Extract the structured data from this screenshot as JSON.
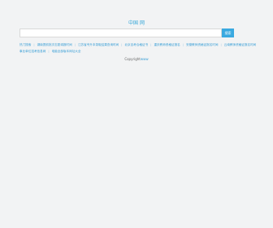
{
  "header": {
    "title": "中国 网"
  },
  "search": {
    "placeholder": "",
    "button_label": "搜索"
  },
  "links": {
    "row1": [
      "热门搜索",
      "湖南提前批次志愿填报时间",
      "江苏省专升本录取结果查询时间",
      "北京自考合格证书",
      "重庆教师资格证报名",
      "安徽教师资格证报名时间",
      "云南教师资格证报名时间"
    ],
    "row2": [
      "事业单位招考信息网",
      "电脑全部版本网址大全"
    ]
  },
  "footer": {
    "copyright": "Copyright",
    "site": "www"
  }
}
